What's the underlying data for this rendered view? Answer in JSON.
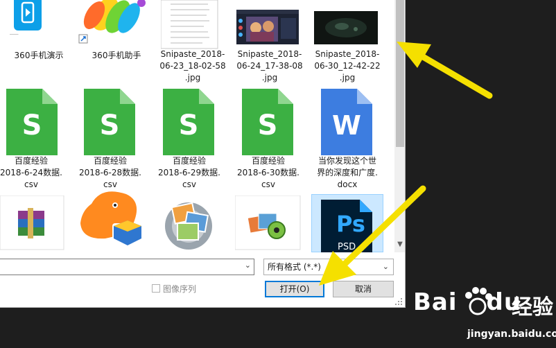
{
  "files": [
    {
      "name": "360手机演示"
    },
    {
      "name": "360手机助手"
    },
    {
      "name": "Snipaste_2018-\n06-23_18-02-58\n.jpg"
    },
    {
      "name": "Snipaste_2018-\n06-24_17-38-08\n.jpg"
    },
    {
      "name": "Snipaste_2018-\n06-30_12-42-22\n.jpg"
    },
    {
      "name": "百度经验\n2018-6-24数据.\ncsv"
    },
    {
      "name": "百度经验\n2018-6-28数据.\ncsv"
    },
    {
      "name": "百度经验\n2018-6-29数据.\ncsv"
    },
    {
      "name": "百度经验\n2018-6-30数据.\ncsv"
    },
    {
      "name": "当你发现这个世\n界的深度和广度.\ndocx"
    }
  ],
  "footer": {
    "file_name_value": "",
    "file_type_selected": "所有格式 (*.*)",
    "image_sequence_label": "图像序列",
    "open_label": "打开(O)",
    "cancel_label": "取消"
  },
  "icons": {
    "csv": "wps-spreadsheet-icon",
    "docx": "wps-writer-icon",
    "ps_label": "Ps",
    "psd_label": "PSD",
    "csv_letter": "S",
    "doc_letter": "W"
  },
  "colors": {
    "csv_green": "#3cb043",
    "doc_blue": "#3d7de0",
    "ps_dark": "#001d34",
    "ps_cyan": "#31a8ff",
    "open_focus": "#0078d7",
    "annotation_yellow": "#f5e000"
  },
  "watermark": {
    "brand": "Bai",
    "brand2": "du",
    "text": "经验",
    "url": "jingyan.baidu.com"
  }
}
